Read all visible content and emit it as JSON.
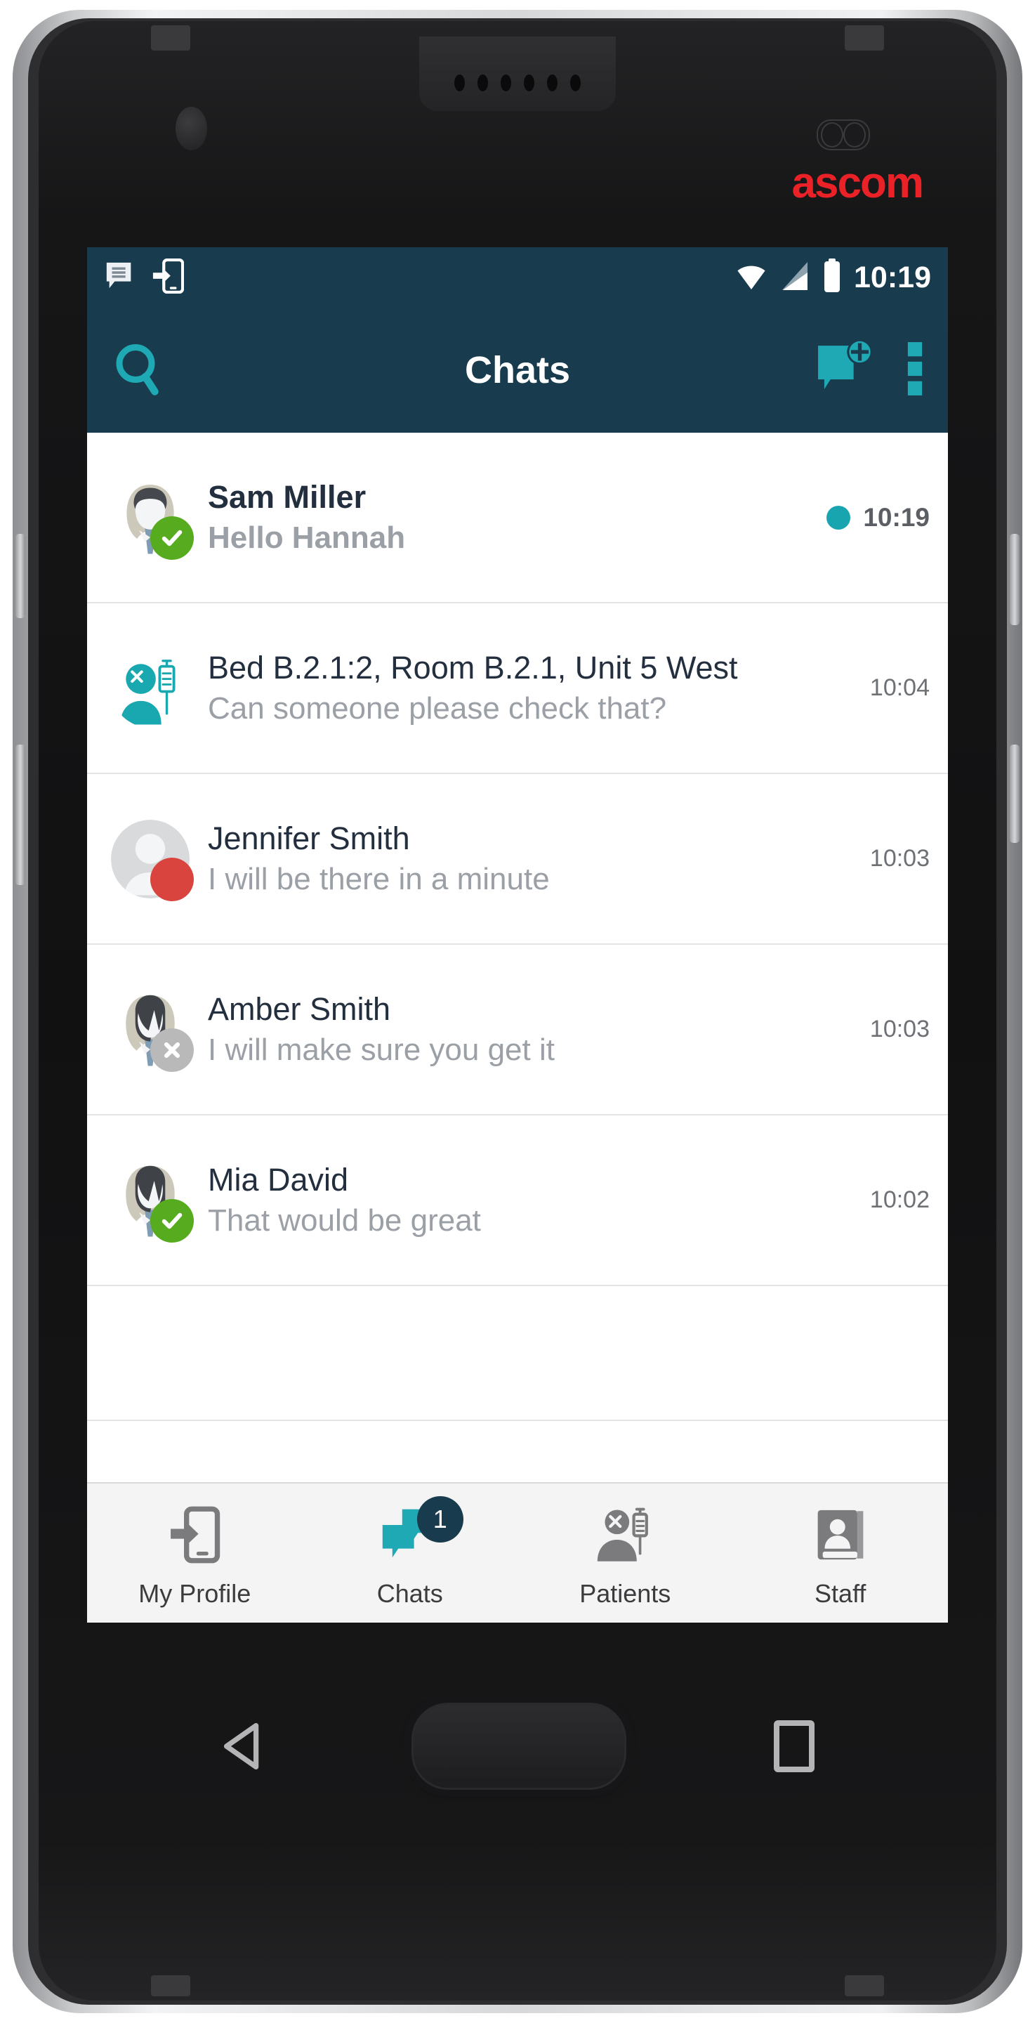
{
  "device": {
    "brand_logo": "ascom",
    "brand_logo_color": "#ea2127",
    "earpiece_icon": "speaker-grille",
    "front_camera_icon": "front-camera",
    "proximity_sensor_icon": "proximity-sensor",
    "softkeys": {
      "back_icon": "back-triangle-icon",
      "home_icon": "home-button-icon",
      "recents_icon": "recents-square-icon"
    }
  },
  "statusbar": {
    "time": "10:19",
    "left_icons": [
      "message-bubble-icon",
      "phone-login-icon"
    ],
    "right_icons": [
      "wifi-icon",
      "cellular-signal-icon",
      "battery-full-icon"
    ],
    "background": "#183b4e"
  },
  "appbar": {
    "title": "Chats",
    "search_icon": "search-icon",
    "new_chat_icon": "new-chat-icon",
    "overflow_icon": "overflow-menu-icon",
    "accent": "#1fa9b4",
    "background": "#183b4e"
  },
  "chats": [
    {
      "name": "Sam Miller",
      "message": "Hello Hannah",
      "time": "10:19",
      "unread": true,
      "unread_dot_color": "#18a5b0",
      "avatar": "male-doctor-avatar",
      "presence": "available",
      "presence_icon": "check-badge-icon",
      "presence_color": "#56ab1e"
    },
    {
      "name": "Bed B.2.1:2, Room B.2.1, Unit 5 West",
      "message": "Can someone please check that?",
      "time": "10:04",
      "unread": false,
      "avatar": "patient-iv-icon",
      "presence": "none",
      "presence_icon": "",
      "presence_color": ""
    },
    {
      "name": "Jennifer Smith",
      "message": "I will be there in a minute",
      "time": "10:03",
      "unread": false,
      "avatar": "generic-person-avatar",
      "presence": "busy",
      "presence_icon": "busy-badge-icon",
      "presence_color": "#d9453e"
    },
    {
      "name": "Amber Smith",
      "message": "I will make sure you get it",
      "time": "10:03",
      "unread": false,
      "avatar": "female-doctor-avatar",
      "presence": "offline",
      "presence_icon": "cross-badge-icon",
      "presence_color": "#b9b9b9"
    },
    {
      "name": "Mia David",
      "message": "That would be great",
      "time": "10:02",
      "unread": false,
      "avatar": "female-doctor-avatar",
      "presence": "available",
      "presence_icon": "check-badge-icon",
      "presence_color": "#56ab1e"
    }
  ],
  "bottomnav": {
    "items": [
      {
        "label": "My Profile",
        "icon": "profile-phone-icon",
        "active": false,
        "badge": ""
      },
      {
        "label": "Chats",
        "icon": "chats-bubbles-icon",
        "active": true,
        "badge": "1"
      },
      {
        "label": "Patients",
        "icon": "patients-iv-icon",
        "active": false,
        "badge": ""
      },
      {
        "label": "Staff",
        "icon": "staff-book-icon",
        "active": false,
        "badge": ""
      }
    ],
    "active_color": "#1fa9b4",
    "inactive_color": "#7b7b7d",
    "badge_color": "#183b4e"
  }
}
